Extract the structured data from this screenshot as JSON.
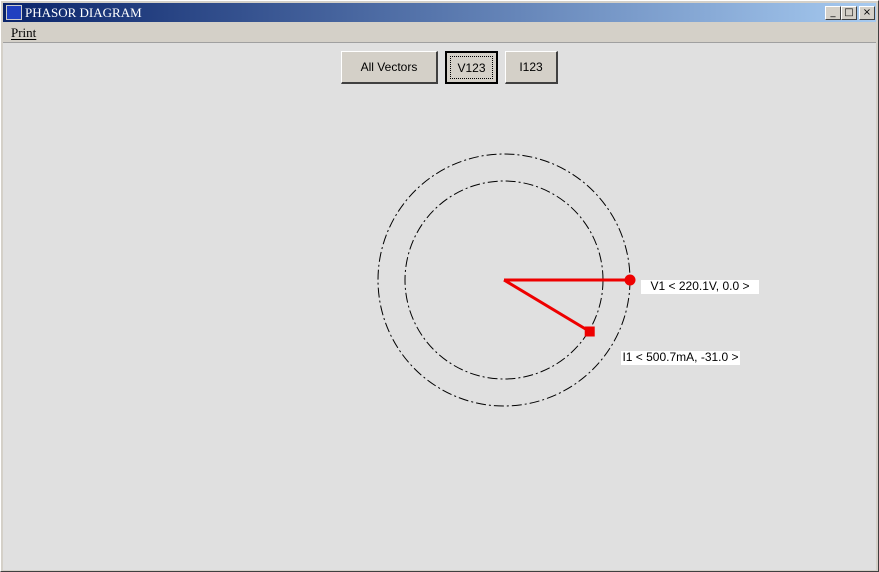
{
  "window": {
    "title": "PHASOR DIAGRAM",
    "controls": [
      "_",
      "□",
      "×"
    ]
  },
  "menu": {
    "print": "Print"
  },
  "toolbar": {
    "all_vectors": "All Vectors",
    "v123": "V123",
    "i123": "I123",
    "selected": "V123"
  },
  "phasors": [
    {
      "name": "V1",
      "label": "V1 < 220.1V, 0.0 >",
      "magnitude": 220.1,
      "unit": "V",
      "angle_deg": 0.0,
      "marker": "circle",
      "color": "#ee0000"
    },
    {
      "name": "I1",
      "label": "I1 < 500.7mA, -31.0 >",
      "magnitude": 500.7,
      "unit": "mA",
      "angle_deg": -31.0,
      "marker": "square",
      "color": "#ee0000"
    }
  ]
}
